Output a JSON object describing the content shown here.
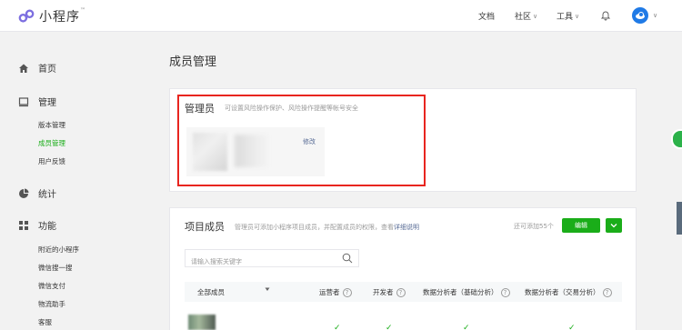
{
  "header": {
    "logo_text": "小程序",
    "logo_tm": "™",
    "nav": [
      {
        "label": "文档",
        "caret": ""
      },
      {
        "label": "社区",
        "caret": "∨"
      },
      {
        "label": "工具",
        "caret": "∨"
      }
    ],
    "avatar_caret": "∨"
  },
  "sidebar": {
    "groups": [
      {
        "label": "首页",
        "icon": "home-icon"
      },
      {
        "label": "管理",
        "icon": "manage-icon"
      },
      {
        "label": "统计",
        "icon": "stats-icon"
      },
      {
        "label": "功能",
        "icon": "features-icon"
      }
    ],
    "manage_items": [
      {
        "label": "版本管理",
        "active": false
      },
      {
        "label": "成员管理",
        "active": true
      },
      {
        "label": "用户反馈",
        "active": false
      }
    ],
    "feature_items": [
      {
        "label": "附近的小程序"
      },
      {
        "label": "微信搜一搜"
      },
      {
        "label": "微信支付"
      },
      {
        "label": "物流助手"
      },
      {
        "label": "客服"
      }
    ]
  },
  "page_title": "成员管理",
  "admin": {
    "title": "管理员",
    "description": "可设置风险操作保护、风险操作提醒等帐号安全",
    "edit_label": "修改"
  },
  "members": {
    "title": "项目成员",
    "description": "管理员可添加小程序项目成员，并配置成员的权限，查看",
    "description_link": "详细说明",
    "quota": "还可添加55个",
    "edit_button": "编辑",
    "search_placeholder": "请输入搜索关键字",
    "columns": {
      "all_members": "全部成员",
      "operator": "运营者",
      "developer": "开发者",
      "analyst_basic": "数据分析者（基础分析）",
      "analyst_trade": "数据分析者（交易分析）"
    },
    "row_checks": [
      "✓",
      "✓",
      "✓",
      "✓"
    ]
  },
  "colors": {
    "accent": "#1aad19",
    "link": "#576b95",
    "highlight": "#e8251f"
  }
}
